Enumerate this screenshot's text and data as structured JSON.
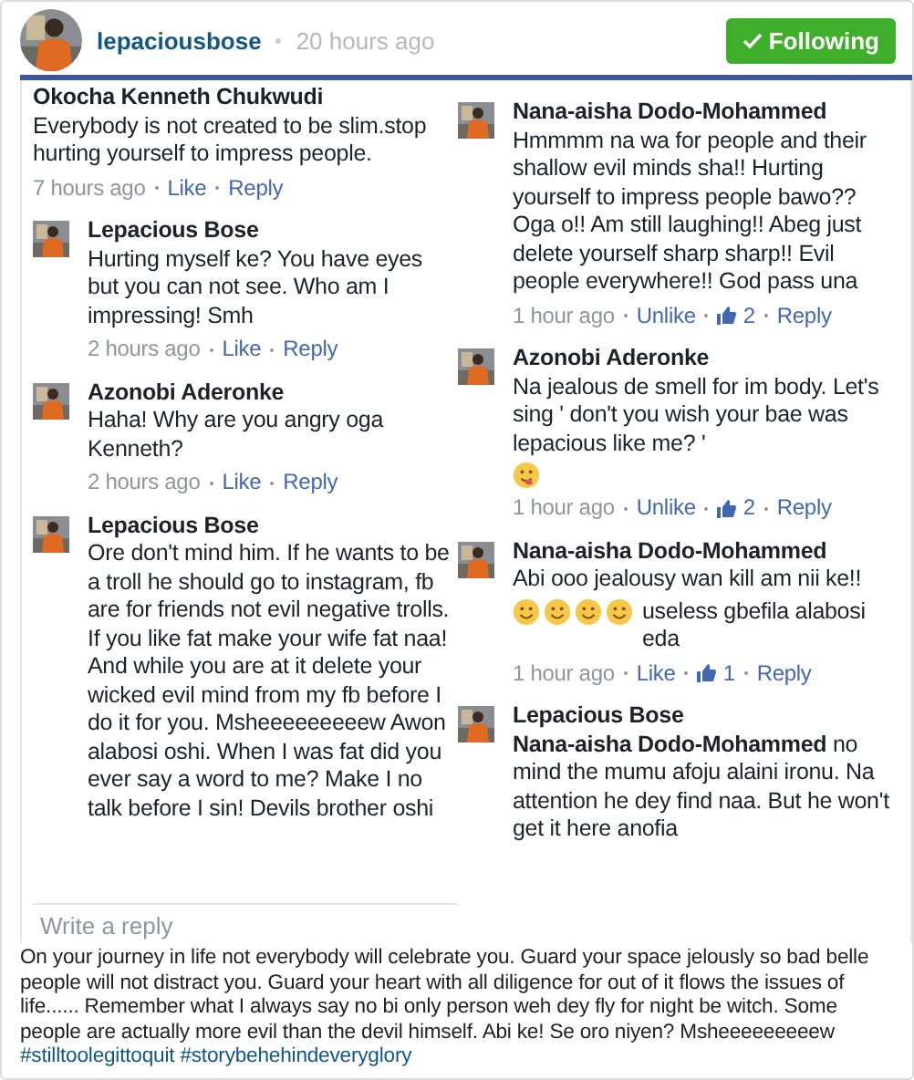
{
  "post_header": {
    "username": "lepaciousbose",
    "time": "20 hours ago",
    "follow_button": {
      "label": "Following",
      "selected": true
    }
  },
  "screenshot": {
    "columns": [
      {
        "comments": [
          {
            "has_avatar": false,
            "author": "Okocha Kenneth Chukwudi",
            "text": "Everybody is not created to be slim.stop hurting yourself to impress people.",
            "time": "7 hours ago",
            "actions": [
              {
                "kind": "link",
                "label": "Like"
              },
              {
                "kind": "link",
                "label": "Reply"
              }
            ]
          },
          {
            "has_avatar": true,
            "author": "Lepacious Bose",
            "text": "Hurting myself ke? You have eyes but you can not see. Who am I impressing! Smh",
            "time": "2 hours ago",
            "actions": [
              {
                "kind": "link",
                "label": "Like"
              },
              {
                "kind": "link",
                "label": "Reply"
              }
            ]
          },
          {
            "has_avatar": true,
            "author": "Azonobi Aderonke",
            "text": "Haha!  Why are you angry oga Kenneth?",
            "time": "2 hours ago",
            "actions": [
              {
                "kind": "link",
                "label": "Like"
              },
              {
                "kind": "link",
                "label": "Reply"
              }
            ]
          },
          {
            "has_avatar": true,
            "author": "Lepacious Bose",
            "text": "Ore don't mind him. If he wants to be a troll he should go to instagram,  fb are for friends not evil negative trolls. If you like fat make your wife fat naa! And while you are at it delete your wicked evil mind from my fb before I do it for you. Msheeeeeeeeew Awon alabosi oshi. When I was fat did you ever say a word to me? Make I no talk before I sin! Devils brother oshi"
          }
        ],
        "reply_field": {
          "placeholder": "Write a reply"
        }
      },
      {
        "comments": [
          {
            "has_avatar": true,
            "author": "Nana-aisha Dodo-Mohammed",
            "text": "Hmmmm na wa for people and their shallow evil minds sha!! Hurting yourself to impress people bawo?? Oga o!! Am still laughing!! Abeg just delete yourself sharp sharp!! Evil people everywhere!! God pass una",
            "time": "1 hour ago",
            "actions": [
              {
                "kind": "link",
                "label": "Unlike"
              },
              {
                "kind": "likes",
                "label": "2"
              },
              {
                "kind": "link",
                "label": "Reply"
              }
            ]
          },
          {
            "has_avatar": true,
            "author": "Azonobi Aderonke",
            "text": "Na jealous de smell for im body. Let's sing ' don't you wish your bae was lepacious like me? '",
            "emojis": [
              {
                "kind": "tongue"
              }
            ],
            "time": "1 hour ago",
            "actions": [
              {
                "kind": "link",
                "label": "Unlike"
              },
              {
                "kind": "likes",
                "label": "2"
              },
              {
                "kind": "link",
                "label": "Reply"
              }
            ]
          },
          {
            "has_avatar": true,
            "author": "Nana-aisha Dodo-Mohammed",
            "text": "Abi ooo jealousy wan kill am nii ke!!",
            "emojis": [
              {
                "kind": "smile"
              },
              {
                "kind": "smile"
              },
              {
                "kind": "smile"
              },
              {
                "kind": "smile"
              }
            ],
            "emoji_text": "useless gbefila alabosi eda",
            "time": "1 hour ago",
            "actions": [
              {
                "kind": "link",
                "label": "Like"
              },
              {
                "kind": "likes",
                "label": "1"
              },
              {
                "kind": "link",
                "label": "Reply"
              }
            ]
          },
          {
            "has_avatar": true,
            "author": "Lepacious Bose",
            "text": "**Nana-aisha Dodo-Mohammed** no mind the mumu afoju alaini ironu. Na attention he dey find naa. But he won't get it here anofia"
          }
        ]
      }
    ]
  },
  "caption": {
    "text": "On your journey in life not everybody will celebrate you. Guard your space jelously so bad belle people will not distract you. Guard your heart with all diligence for out of it flows the issues of life...... Remember what I always say no bi only person weh dey fly for night be witch. Some people are actually more evil than the devil himself. Abi ke! Se oro niyen? Msheeeeeeeeew",
    "hashtags": "#stilltoolegittoquit #storybehehindeveryglory"
  }
}
